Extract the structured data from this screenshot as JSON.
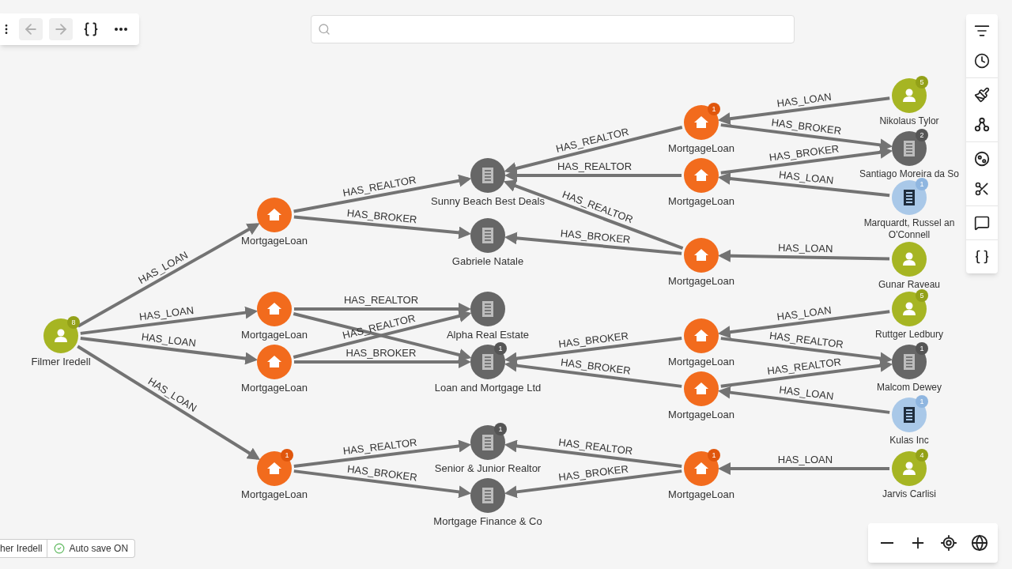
{
  "toolbar": {
    "buttons": [
      {
        "kind": "menu",
        "disabled": false
      },
      {
        "kind": "back",
        "disabled": true
      },
      {
        "kind": "forward",
        "disabled": true
      },
      {
        "kind": "braces",
        "disabled": false
      },
      {
        "kind": "more",
        "disabled": false
      }
    ]
  },
  "side_toolbar": {
    "groups": [
      {
        "tools": [
          {
            "kind": "filter"
          },
          {
            "kind": "history"
          }
        ]
      },
      {
        "tools": [
          {
            "kind": "style"
          },
          {
            "kind": "graph"
          }
        ]
      },
      {
        "tools": [
          {
            "kind": "layout"
          },
          {
            "kind": "cut"
          }
        ]
      },
      {
        "tools": [
          {
            "kind": "comment"
          }
        ]
      },
      {
        "tools": [
          {
            "kind": "braces"
          }
        ]
      }
    ]
  },
  "zoom_controls": [
    {
      "kind": "zoom-out"
    },
    {
      "kind": "zoom-in"
    },
    {
      "kind": "locate"
    },
    {
      "kind": "globe"
    }
  ],
  "status_bar": {
    "items": [
      {
        "kind": "text",
        "text": "her Iredell"
      },
      {
        "kind": "autosave",
        "text": "Auto save ON",
        "on": true
      }
    ]
  },
  "graph": {
    "nodes": [
      {
        "kind": "person",
        "label": "Filmer Iredell",
        "badge": "8"
      },
      {
        "kind": "loan",
        "label": "MortgageLoan"
      },
      {
        "kind": "loan",
        "label": "MortgageLoan"
      },
      {
        "kind": "loan",
        "label": "MortgageLoan"
      },
      {
        "kind": "loan",
        "label": "MortgageLoan",
        "badge": "1"
      },
      {
        "kind": "company",
        "label": "Sunny Beach Best Deals"
      },
      {
        "kind": "company",
        "label": "Gabriele Natale"
      },
      {
        "kind": "company",
        "label": "Alpha Real Estate"
      },
      {
        "kind": "company",
        "label": "Loan and Mortgage Ltd",
        "badge": "1"
      },
      {
        "kind": "company",
        "label": "Senior & Junior Realtor",
        "badge": "1"
      },
      {
        "kind": "company",
        "label": "Mortgage Finance & Co"
      },
      {
        "kind": "loan",
        "label": "MortgageLoan",
        "badge": "1"
      },
      {
        "kind": "loan",
        "label": "MortgageLoan"
      },
      {
        "kind": "loan",
        "label": "MortgageLoan"
      },
      {
        "kind": "loan",
        "label": "MortgageLoan"
      },
      {
        "kind": "loan",
        "label": "MortgageLoan"
      },
      {
        "kind": "loan",
        "label": "MortgageLoan",
        "badge": "1"
      },
      {
        "kind": "person",
        "label": "Nikolaus Tylor",
        "badge": "5"
      },
      {
        "kind": "company",
        "label": "Santiago Moreira da So",
        "badge": "2"
      },
      {
        "kind": "bank",
        "label": "Marquardt, Russel an O'Connell",
        "badge": "1"
      },
      {
        "kind": "person",
        "label": "Gunar Raveau"
      },
      {
        "kind": "person",
        "label": "Ruttger Ledbury",
        "badge": "5"
      },
      {
        "kind": "company",
        "label": "Malcom Dewey",
        "badge": "1"
      },
      {
        "kind": "bank",
        "label": "Kulas Inc",
        "badge": "1"
      },
      {
        "kind": "person",
        "label": "Jarvis Carlisi",
        "badge": "4"
      }
    ],
    "edges": [
      {
        "kind": "labeled",
        "label": "HAS_LOAN"
      },
      {
        "kind": "labeled",
        "label": "HAS_LOAN"
      },
      {
        "kind": "labeled",
        "label": "HAS_LOAN"
      },
      {
        "kind": "labeled",
        "label": "HAS_LOAN"
      },
      {
        "kind": "labeled",
        "label": "HAS_REALTOR"
      },
      {
        "kind": "labeled",
        "label": "HAS_BROKER"
      },
      {
        "kind": "labeled",
        "label": "HAS_REALTOR"
      },
      {
        "kind": "unlabeled"
      },
      {
        "kind": "labeled",
        "label": "HAS_REALTOR"
      },
      {
        "kind": "labeled",
        "label": "HAS_BROKER"
      },
      {
        "kind": "labeled",
        "label": "HAS_REALTOR"
      },
      {
        "kind": "labeled",
        "label": "HAS_BROKER"
      },
      {
        "kind": "labeled",
        "label": "HAS_REALTOR"
      },
      {
        "kind": "labeled",
        "label": "HAS_REALTOR"
      },
      {
        "kind": "labeled",
        "label": "HAS_REALTOR"
      },
      {
        "kind": "labeled",
        "label": "HAS_BROKER"
      },
      {
        "kind": "labeled",
        "label": "HAS_LOAN"
      },
      {
        "kind": "labeled",
        "label": "HAS_BROKER"
      },
      {
        "kind": "labeled",
        "label": "HAS_BROKER"
      },
      {
        "kind": "labeled",
        "label": "HAS_LOAN"
      },
      {
        "kind": "labeled",
        "label": "HAS_LOAN"
      },
      {
        "kind": "labeled",
        "label": "HAS_BROKER"
      },
      {
        "kind": "labeled",
        "label": "HAS_BROKER"
      },
      {
        "kind": "labeled",
        "label": "HAS_LOAN"
      },
      {
        "kind": "labeled",
        "label": "HAS_REALTOR"
      },
      {
        "kind": "labeled",
        "label": "HAS_REALTOR"
      },
      {
        "kind": "labeled",
        "label": "HAS_LOAN"
      },
      {
        "kind": "labeled",
        "label": "HAS_REALTOR"
      },
      {
        "kind": "labeled",
        "label": "HAS_BROKER"
      },
      {
        "kind": "labeled",
        "label": "HAS_LOAN"
      }
    ]
  }
}
